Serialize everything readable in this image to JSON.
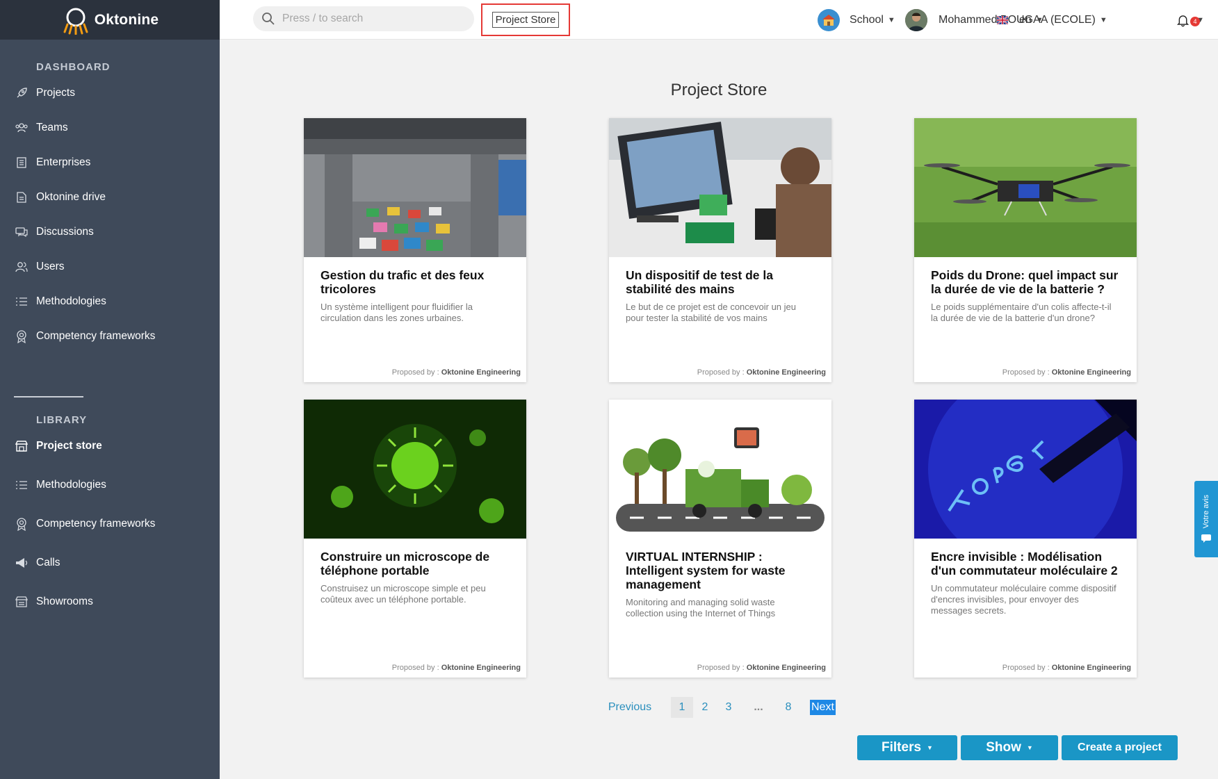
{
  "app": {
    "name": "Oktonine"
  },
  "sidebar": {
    "dashboard_label": "DASHBOARD",
    "dashboard_items": [
      {
        "label": "Projects",
        "icon": "rocket-icon"
      },
      {
        "label": "Teams",
        "icon": "team-icon"
      },
      {
        "label": "Enterprises",
        "icon": "building-icon"
      },
      {
        "label": "Oktonine drive",
        "icon": "drive-icon"
      },
      {
        "label": "Discussions",
        "icon": "chat-icon"
      },
      {
        "label": "Users",
        "icon": "users-icon"
      },
      {
        "label": "Methodologies",
        "icon": "list-icon"
      },
      {
        "label": "Competency frameworks",
        "icon": "badge-icon"
      }
    ],
    "library_label": "LIBRARY",
    "library_items": [
      {
        "label": "Project store",
        "icon": "store-icon",
        "active": true
      },
      {
        "label": "Methodologies",
        "icon": "list-icon"
      },
      {
        "label": "Competency frameworks",
        "icon": "badge-icon"
      },
      {
        "label": "Calls",
        "icon": "megaphone-icon"
      },
      {
        "label": "Showrooms",
        "icon": "showroom-icon"
      }
    ]
  },
  "topbar": {
    "search_placeholder": "Press / to search",
    "breadcrumb": "Project Store",
    "school_label": "School",
    "user_name": "Mohammed BOUGAA (ECOLE)",
    "language": "en",
    "notification_count": "4"
  },
  "main": {
    "title": "Project Store",
    "proposed_prefix": "Proposed by : ",
    "cards": [
      {
        "title": "Gestion du trafic et des feux tricolores",
        "description": "Un système intelligent pour fluidifier la circulation dans les zones urbaines.",
        "author": "Oktonine Engineering",
        "image": "traffic-photo"
      },
      {
        "title": "Un dispositif de test de la stabilité des mains",
        "description": "Le but de ce projet est de concevoir un jeu pour tester la stabilité de vos mains",
        "author": "Oktonine Engineering",
        "image": "kid-computer-photo"
      },
      {
        "title": "Poids du Drone: quel impact sur la durée de vie de la batterie ?",
        "description": "Le poids supplémentaire d'un colis affecte-t-il la durée de vie de la batterie d'un drone?",
        "author": "Oktonine Engineering",
        "image": "drone-photo"
      },
      {
        "title": "Construire un microscope de téléphone portable",
        "description": "Construisez un microscope simple et peu coûteux avec un téléphone portable.",
        "author": "Oktonine Engineering",
        "image": "virus-image"
      },
      {
        "title": "VIRTUAL INTERNSHIP : Intelligent system for waste management",
        "description": " Monitoring and managing solid waste collection using the Internet of Things",
        "author": "Oktonine Engineering",
        "image": "garbage-truck-illustration"
      },
      {
        "title": "Encre invisible : Modélisation d'un commutateur moléculaire 2",
        "description": "Un commutateur moléculaire comme dispositif d'encres invisibles, pour envoyer des messages secrets.",
        "author": "Oktonine Engineering",
        "image": "uv-ink-photo"
      }
    ]
  },
  "pagination": {
    "previous": "Previous",
    "pages": [
      "1",
      "2",
      "3",
      "...",
      "8"
    ],
    "current": "1",
    "next": "Next"
  },
  "actions": {
    "filters": "Filters",
    "show": "Show",
    "create": "Create a project"
  },
  "feedback_tab": {
    "label": "Votre avis"
  },
  "colors": {
    "sidebar": "#3f4a5a",
    "accent": "#1a96c6",
    "highlight": "#e53935"
  }
}
